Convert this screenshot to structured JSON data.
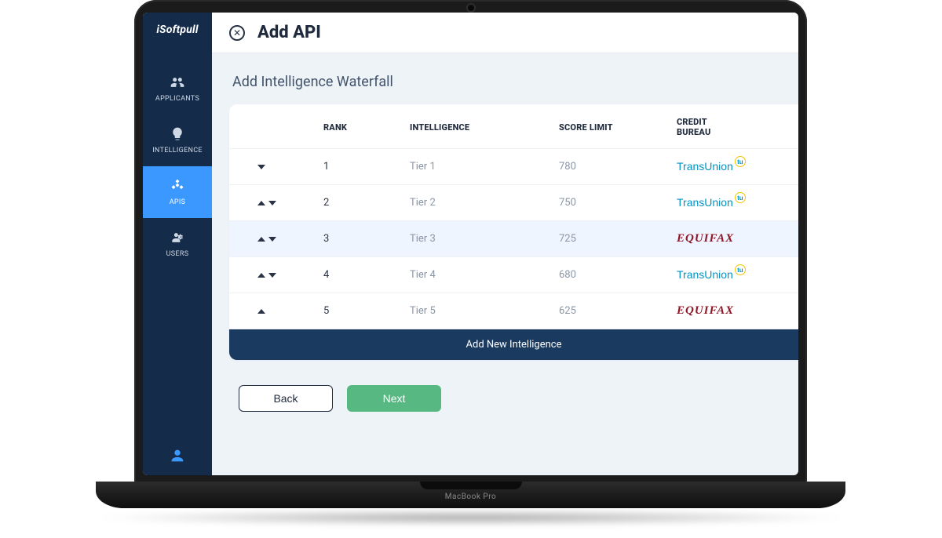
{
  "device_brand": "MacBook Pro",
  "brand": "iSoftpull",
  "sidebar": {
    "items": [
      {
        "id": "applicants",
        "label": "APPLICANTS",
        "icon": "people-icon",
        "active": false
      },
      {
        "id": "intelligence",
        "label": "INTELLIGENCE",
        "icon": "bulb-icon",
        "active": false
      },
      {
        "id": "apis",
        "label": "APIS",
        "icon": "diamond-icon",
        "active": true
      },
      {
        "id": "users",
        "label": "USERS",
        "icon": "gear-user-icon",
        "active": false
      }
    ]
  },
  "header": {
    "title": "Add API"
  },
  "section": {
    "title": "Add Intelligence Waterfall"
  },
  "table": {
    "headers": {
      "rank": "RANK",
      "intelligence": "INTELLIGENCE",
      "score_limit": "SCORE LIMIT",
      "credit_bureau": "CREDIT BUREAU"
    },
    "rows": [
      {
        "rank": "1",
        "intel": "Tier 1",
        "score": "780",
        "bureau": "transunion",
        "order": {
          "up": false,
          "down": true
        },
        "highlight": false
      },
      {
        "rank": "2",
        "intel": "Tier 2",
        "score": "750",
        "bureau": "transunion",
        "order": {
          "up": true,
          "down": true
        },
        "highlight": false
      },
      {
        "rank": "3",
        "intel": "Tier 3",
        "score": "725",
        "bureau": "equifax",
        "order": {
          "up": true,
          "down": true
        },
        "highlight": true
      },
      {
        "rank": "4",
        "intel": "Tier 4",
        "score": "680",
        "bureau": "transunion",
        "order": {
          "up": true,
          "down": true
        },
        "highlight": false
      },
      {
        "rank": "5",
        "intel": "Tier 5",
        "score": "625",
        "bureau": "equifax",
        "order": {
          "up": true,
          "down": false
        },
        "highlight": false
      }
    ],
    "add_label": "Add New Intelligence"
  },
  "bureaus": {
    "transunion": {
      "text": "TransUnion",
      "mark": "tu"
    },
    "equifax": {
      "text": "EQUIFAX"
    }
  },
  "actions": {
    "back": "Back",
    "next": "Next"
  }
}
